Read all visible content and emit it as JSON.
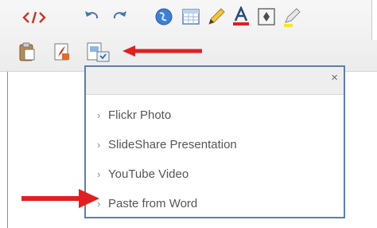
{
  "toolbar": {
    "row1_icons": [
      "html-source-icon",
      "undo-icon",
      "redo-icon",
      "insert-web-icon",
      "table-icon",
      "pencil-icon",
      "text-color-icon",
      "insert-anchor-icon",
      "highlighter-icon"
    ],
    "row2_icons": [
      "paste-icon",
      "paste-pdf-icon",
      "insert-embed-dropdown-icon"
    ]
  },
  "popup": {
    "close_label": "×",
    "items": [
      {
        "label": "Flickr Photo"
      },
      {
        "label": "SlideShare Presentation"
      },
      {
        "label": "YouTube Video"
      },
      {
        "label": "Paste from Word"
      }
    ]
  },
  "colors": {
    "popup_border": "#5f7fa8",
    "arrow": "#e02020",
    "text_color_bar": "#e02020"
  }
}
